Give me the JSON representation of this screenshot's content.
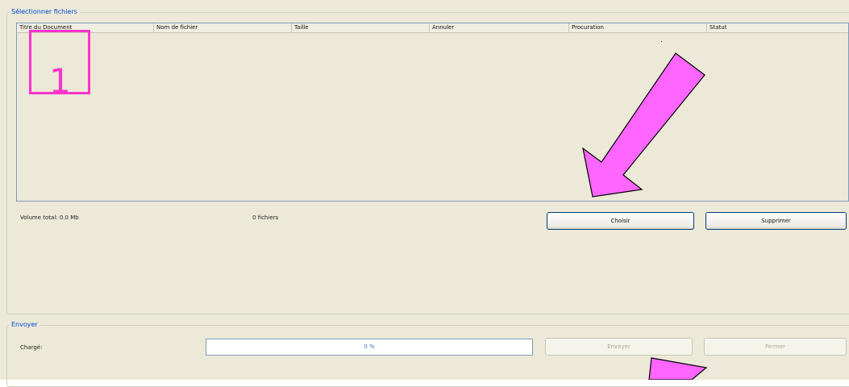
{
  "select_group": {
    "legend": "Sélectionner fichiers",
    "columns": [
      "Titre du Document",
      "Nom de fichier",
      "Taille",
      "Annuler",
      "Procuration",
      "Statut"
    ],
    "rows": [],
    "volume_total": "Volume total: 0.0 Mb",
    "file_count": "0 fichiers",
    "choose_button": "Choisir",
    "delete_button": "Supprimer"
  },
  "send_group": {
    "legend": "Envoyer",
    "loaded_label": "Chargé:",
    "progress_text": "0 %",
    "progress_value": 0,
    "send_button": "Envoyer",
    "close_button": "Fermer"
  },
  "annotations": {
    "marker_number": "1",
    "arrow_color": "#ff66ff",
    "marker_color": "#ff33cc"
  }
}
